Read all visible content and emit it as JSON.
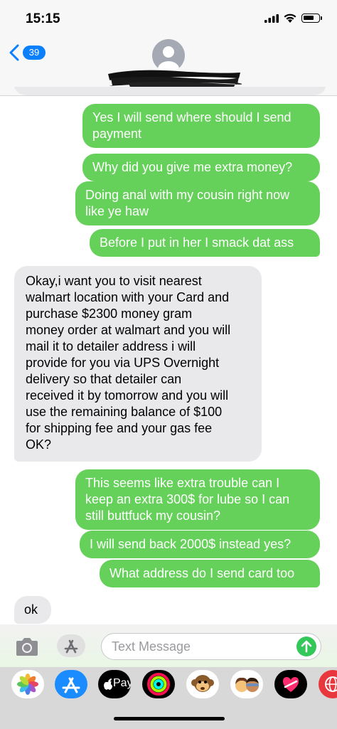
{
  "status_bar": {
    "time": "15:15"
  },
  "nav": {
    "back_count": "39"
  },
  "messages": [
    {
      "text": "Yes I will send where should I send\npayment"
    },
    {
      "text": "Why did you give me extra money?"
    },
    {
      "text": "Doing anal with my cousin right now\nlike ye haw"
    },
    {
      "text": "Before I put in her I smack dat ass"
    },
    {
      "text": "Okay,i want you to visit nearest\nwalmart location with your Card and\npurchase $2300 money gram\nmoney order at walmart and you will\nmail it to detailer address i will\nprovide for you via UPS Overnight\ndelivery so that detailer can\nreceived it by tomorrow and you will\nuse the remaining balance of $100\nfor shipping fee and your gas fee\nOK?"
    },
    {
      "text": "This seems like extra trouble can I\nkeep an extra 300$ for lube so I can\nstill buttfuck my cousin?"
    },
    {
      "text": "I will send back 2000$ instead yes?"
    },
    {
      "text": "What address do I send card too"
    },
    {
      "text": "ok"
    }
  ],
  "input": {
    "placeholder": "Text Message"
  },
  "app_drawer": {
    "apple_pay_label": "Pay",
    "apps": [
      "photos-icon",
      "app-store-icon",
      "apple-pay-icon",
      "activity-icon",
      "monkey-memoji-icon",
      "memoji-icon",
      "digital-touch-icon",
      "web-search-icon"
    ]
  },
  "colors": {
    "sent_bubble": "#65d15a",
    "received_bubble": "#e9e9eb",
    "badge": "#0b80ff"
  }
}
